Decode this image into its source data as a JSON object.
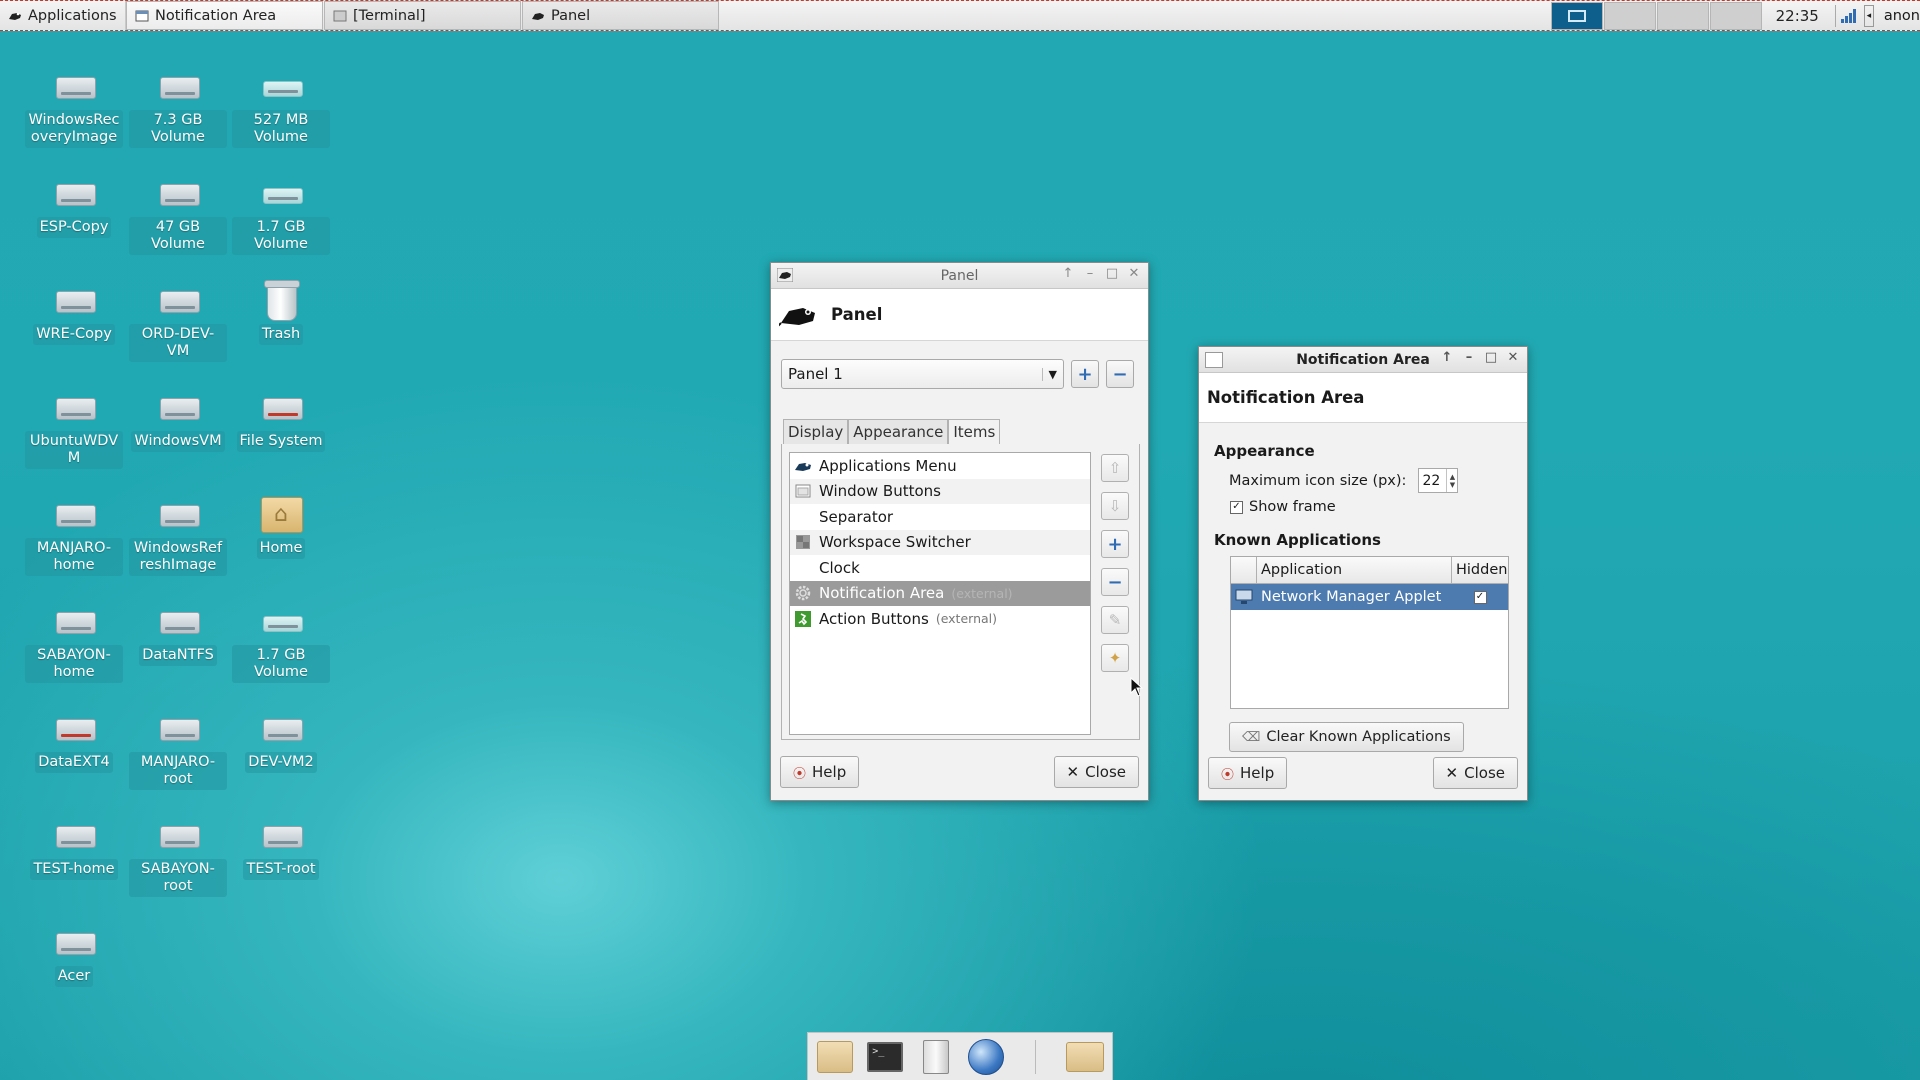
{
  "top_panel": {
    "apps_label": "Applications",
    "tasks": [
      {
        "label": "Notification Area"
      },
      {
        "label": "[Terminal]"
      },
      {
        "label": "Panel"
      }
    ],
    "clock": "22:35",
    "user": "anon"
  },
  "desktop": {
    "icons": [
      {
        "label": "WindowsRecoveryImage",
        "type": "drive"
      },
      {
        "label": "7.3 GB Volume",
        "type": "drive"
      },
      {
        "label": "527 MB Volume",
        "type": "drive-flat"
      },
      {
        "label": "ESP-Copy",
        "type": "drive"
      },
      {
        "label": "47 GB Volume",
        "type": "drive"
      },
      {
        "label": "1.7 GB Volume",
        "type": "drive-flat"
      },
      {
        "label": "WRE-Copy",
        "type": "drive"
      },
      {
        "label": "ORD-DEV-VM",
        "type": "drive"
      },
      {
        "label": "Trash",
        "type": "trash"
      },
      {
        "label": "UbuntuWDVM",
        "type": "drive"
      },
      {
        "label": "WindowsVM",
        "type": "drive"
      },
      {
        "label": "File System",
        "type": "drive-red"
      },
      {
        "label": "MANJARO-home",
        "type": "drive"
      },
      {
        "label": "WindowsRefreshImage",
        "type": "drive"
      },
      {
        "label": "Home",
        "type": "home"
      },
      {
        "label": "SABAYON-home",
        "type": "drive"
      },
      {
        "label": "DataNTFS",
        "type": "drive"
      },
      {
        "label": "1.7 GB Volume",
        "type": "drive-flat"
      },
      {
        "label": "DataEXT4",
        "type": "drive-red"
      },
      {
        "label": "MANJARO-root",
        "type": "drive"
      },
      {
        "label": "DEV-VM2",
        "type": "drive"
      },
      {
        "label": "TEST-home",
        "type": "drive"
      },
      {
        "label": "SABAYON-root",
        "type": "drive"
      },
      {
        "label": "TEST-root",
        "type": "drive"
      },
      {
        "label": "Acer",
        "type": "drive"
      }
    ]
  },
  "panel_window": {
    "title": "Panel",
    "header_title": "Panel",
    "panel_select": "Panel 1",
    "tabs": [
      "Display",
      "Appearance",
      "Items"
    ],
    "active_tab": "Items",
    "items": [
      {
        "label": "Applications Menu",
        "ext": "",
        "icon": "mouse-icon"
      },
      {
        "label": "Window Buttons",
        "ext": "",
        "icon": "window-icon"
      },
      {
        "label": "Separator",
        "ext": "",
        "icon": ""
      },
      {
        "label": "Workspace Switcher",
        "ext": "",
        "icon": "workspace-icon"
      },
      {
        "label": "Clock",
        "ext": "",
        "icon": ""
      },
      {
        "label": "Notification Area",
        "ext": "(external)",
        "icon": "gear-icon",
        "selected": true
      },
      {
        "label": "Action Buttons",
        "ext": "(external)",
        "icon": "exit-icon"
      }
    ],
    "help_label": "Help",
    "close_label": "Close"
  },
  "notif_window": {
    "title": "Notification Area",
    "header_title": "Notification Area",
    "appearance_heading": "Appearance",
    "icon_size_label": "Maximum icon size (px):",
    "icon_size_value": "22",
    "show_frame_label": "Show frame",
    "show_frame_checked": true,
    "known_apps_heading": "Known Applications",
    "columns": [
      "Application",
      "Hidden"
    ],
    "rows": [
      {
        "application": "Network Manager Applet",
        "hidden": true
      }
    ],
    "clear_label": "Clear Known Applications",
    "help_label": "Help",
    "close_label": "Close"
  },
  "dock": {
    "items": [
      "file-manager-icon",
      "terminal-icon",
      "cabinet-icon",
      "web-browser-icon",
      "folder-icon"
    ]
  },
  "colors": {
    "selection": "#4d7bb0",
    "desktop": "#21a9b3",
    "accent_blue": "#2f6cb4"
  }
}
